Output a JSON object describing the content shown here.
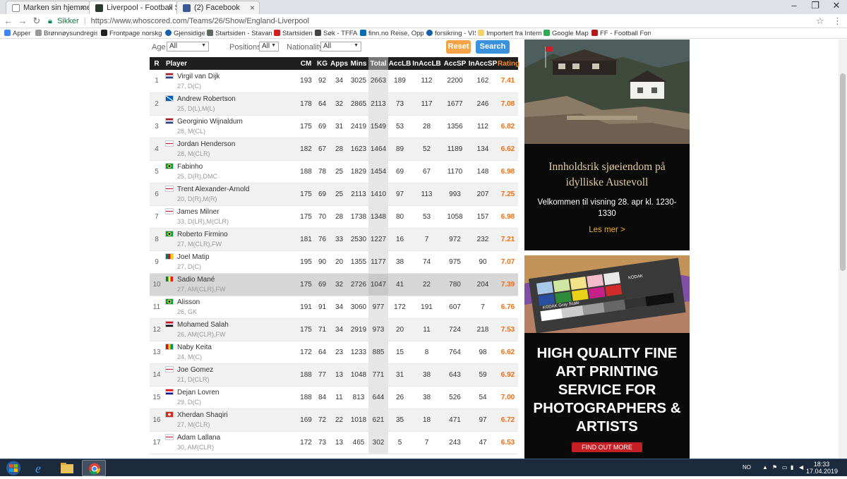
{
  "browser": {
    "tabs": [
      {
        "title": "Marken sin hjemmeside",
        "active": false
      },
      {
        "title": "Liverpool - Football Stati",
        "active": true
      },
      {
        "title": "(2) Facebook",
        "active": false
      }
    ],
    "secure_label": "Sikker",
    "url": "https://www.whoscored.com/Teams/26/Show/England-Liverpool",
    "bookmarks": [
      "Apper",
      "Brønnøysundregistre",
      "Frontpage norskgolf",
      "Gjensidige",
      "Startsiden - Stavange",
      "Startsiden",
      "Søk - TFFAuto",
      "finn.no Reise, Oppdr",
      "forsikring - VIS",
      "Importert fra Internet",
      "Google Maps",
      "FF - Football Forum"
    ]
  },
  "filters": {
    "age_label": "Age",
    "age_value": "All",
    "positions_label": "Positions",
    "positions_value": "All",
    "nationality_label": "Nationality",
    "nationality_value": "All",
    "reset_label": "Reset",
    "search_label": "Search"
  },
  "table": {
    "headers": [
      "R",
      "Player",
      "CM",
      "KG",
      "Apps",
      "Mins",
      "Total",
      "AccLB",
      "InAccLB",
      "AccSP",
      "InAccSP",
      "Rating"
    ],
    "rows": [
      {
        "r": "1",
        "name": "Virgil van Dijk",
        "meta": "27, D(C)",
        "flag": "nl",
        "cm": "193",
        "kg": "92",
        "apps": "34",
        "mins": "3025",
        "total": "2663",
        "acclb": "189",
        "inacclb": "112",
        "accsp": "2200",
        "inaccsp": "162",
        "rating": "7.41"
      },
      {
        "r": "2",
        "name": "Andrew Robertson",
        "meta": "25, D(L),M(L)",
        "flag": "sc",
        "cm": "178",
        "kg": "64",
        "apps": "32",
        "mins": "2865",
        "total": "2113",
        "acclb": "73",
        "inacclb": "117",
        "accsp": "1677",
        "inaccsp": "246",
        "rating": "7.08"
      },
      {
        "r": "3",
        "name": "Georginio Wijnaldum",
        "meta": "28, M(CL)",
        "flag": "nl",
        "cm": "175",
        "kg": "69",
        "apps": "31",
        "mins": "2419",
        "total": "1549",
        "acclb": "53",
        "inacclb": "28",
        "accsp": "1356",
        "inaccsp": "112",
        "rating": "6.82"
      },
      {
        "r": "4",
        "name": "Jordan Henderson",
        "meta": "28, M(CLR)",
        "flag": "en",
        "cm": "182",
        "kg": "67",
        "apps": "28",
        "mins": "1623",
        "total": "1464",
        "acclb": "89",
        "inacclb": "52",
        "accsp": "1189",
        "inaccsp": "134",
        "rating": "6.62"
      },
      {
        "r": "5",
        "name": "Fabinho",
        "meta": "25, D(R),DMC",
        "flag": "br",
        "cm": "188",
        "kg": "78",
        "apps": "25",
        "mins": "1829",
        "total": "1454",
        "acclb": "69",
        "inacclb": "67",
        "accsp": "1170",
        "inaccsp": "148",
        "rating": "6.98"
      },
      {
        "r": "6",
        "name": "Trent Alexander-Arnold",
        "meta": "20, D(R),M(R)",
        "flag": "en",
        "cm": "175",
        "kg": "69",
        "apps": "25",
        "mins": "2113",
        "total": "1410",
        "acclb": "97",
        "inacclb": "113",
        "accsp": "993",
        "inaccsp": "207",
        "rating": "7.25"
      },
      {
        "r": "7",
        "name": "James Milner",
        "meta": "33, D(LR),M(CLR)",
        "flag": "en",
        "cm": "175",
        "kg": "70",
        "apps": "28",
        "mins": "1738",
        "total": "1348",
        "acclb": "80",
        "inacclb": "53",
        "accsp": "1058",
        "inaccsp": "157",
        "rating": "6.98"
      },
      {
        "r": "8",
        "name": "Roberto Firmino",
        "meta": "27, M(CLR),FW",
        "flag": "br",
        "cm": "181",
        "kg": "76",
        "apps": "33",
        "mins": "2530",
        "total": "1227",
        "acclb": "16",
        "inacclb": "7",
        "accsp": "972",
        "inaccsp": "232",
        "rating": "7.21"
      },
      {
        "r": "9",
        "name": "Joel Matip",
        "meta": "27, D(C)",
        "flag": "cm",
        "cm": "195",
        "kg": "90",
        "apps": "20",
        "mins": "1355",
        "total": "1177",
        "acclb": "38",
        "inacclb": "74",
        "accsp": "975",
        "inaccsp": "90",
        "rating": "7.07"
      },
      {
        "r": "10",
        "name": "Sadio Mané",
        "meta": "27, AM(CLR),FW",
        "flag": "sn",
        "cm": "175",
        "kg": "69",
        "apps": "32",
        "mins": "2726",
        "total": "1047",
        "acclb": "41",
        "inacclb": "22",
        "accsp": "780",
        "inaccsp": "204",
        "rating": "7.39"
      },
      {
        "r": "11",
        "name": "Alisson",
        "meta": "26, GK",
        "flag": "br",
        "cm": "191",
        "kg": "91",
        "apps": "34",
        "mins": "3060",
        "total": "977",
        "acclb": "172",
        "inacclb": "191",
        "accsp": "607",
        "inaccsp": "7",
        "rating": "6.76"
      },
      {
        "r": "12",
        "name": "Mohamed Salah",
        "meta": "26, AM(CLR),FW",
        "flag": "eg",
        "cm": "175",
        "kg": "71",
        "apps": "34",
        "mins": "2919",
        "total": "973",
        "acclb": "20",
        "inacclb": "11",
        "accsp": "724",
        "inaccsp": "218",
        "rating": "7.53"
      },
      {
        "r": "13",
        "name": "Naby Keita",
        "meta": "24, M(C)",
        "flag": "gn",
        "cm": "172",
        "kg": "64",
        "apps": "23",
        "mins": "1233",
        "total": "885",
        "acclb": "15",
        "inacclb": "8",
        "accsp": "764",
        "inaccsp": "98",
        "rating": "6.62"
      },
      {
        "r": "14",
        "name": "Joe Gomez",
        "meta": "21, D(CLR)",
        "flag": "en",
        "cm": "188",
        "kg": "77",
        "apps": "13",
        "mins": "1048",
        "total": "771",
        "acclb": "31",
        "inacclb": "38",
        "accsp": "643",
        "inaccsp": "59",
        "rating": "6.92"
      },
      {
        "r": "15",
        "name": "Dejan Lovren",
        "meta": "29, D(C)",
        "flag": "hr",
        "cm": "188",
        "kg": "84",
        "apps": "11",
        "mins": "813",
        "total": "644",
        "acclb": "26",
        "inacclb": "38",
        "accsp": "526",
        "inaccsp": "54",
        "rating": "7.00"
      },
      {
        "r": "16",
        "name": "Xherdan Shaqiri",
        "meta": "27, M(CLR)",
        "flag": "ch",
        "cm": "169",
        "kg": "72",
        "apps": "22",
        "mins": "1018",
        "total": "621",
        "acclb": "35",
        "inacclb": "18",
        "accsp": "471",
        "inaccsp": "97",
        "rating": "6.72"
      },
      {
        "r": "17",
        "name": "Adam Lallana",
        "meta": "30, AM(CLR)",
        "flag": "en",
        "cm": "172",
        "kg": "73",
        "apps": "13",
        "mins": "465",
        "total": "302",
        "acclb": "5",
        "inacclb": "7",
        "accsp": "243",
        "inaccsp": "47",
        "rating": "6.53"
      }
    ]
  },
  "ads": {
    "house_headline": "Innholdsrik sjøeiendom på idylliske Austevoll",
    "house_sub": "Velkommen til visning 28. apr kl. 1230-1330",
    "house_cta": "Les mer >",
    "print_headline": "HIGH QUALITY FINE ART PRINTING SERVICE FOR PHOTOGRAPHERS & ARTISTS",
    "print_cta": "FIND OUT MORE",
    "print_chart_brand": "KODAK",
    "print_chart_text": "KODAK Gray Scale"
  },
  "taskbar": {
    "lang": "NO",
    "time": "18:33",
    "date": "17.04.2019"
  },
  "colors": {
    "rating": "#f06d13",
    "header_bg": "#1f1f1f",
    "reset": "#f4a346",
    "search": "#3a91dd",
    "ad_gold": "#e2cda0",
    "ad_cta": "#f5b12a",
    "ad_red": "#c41f24"
  }
}
